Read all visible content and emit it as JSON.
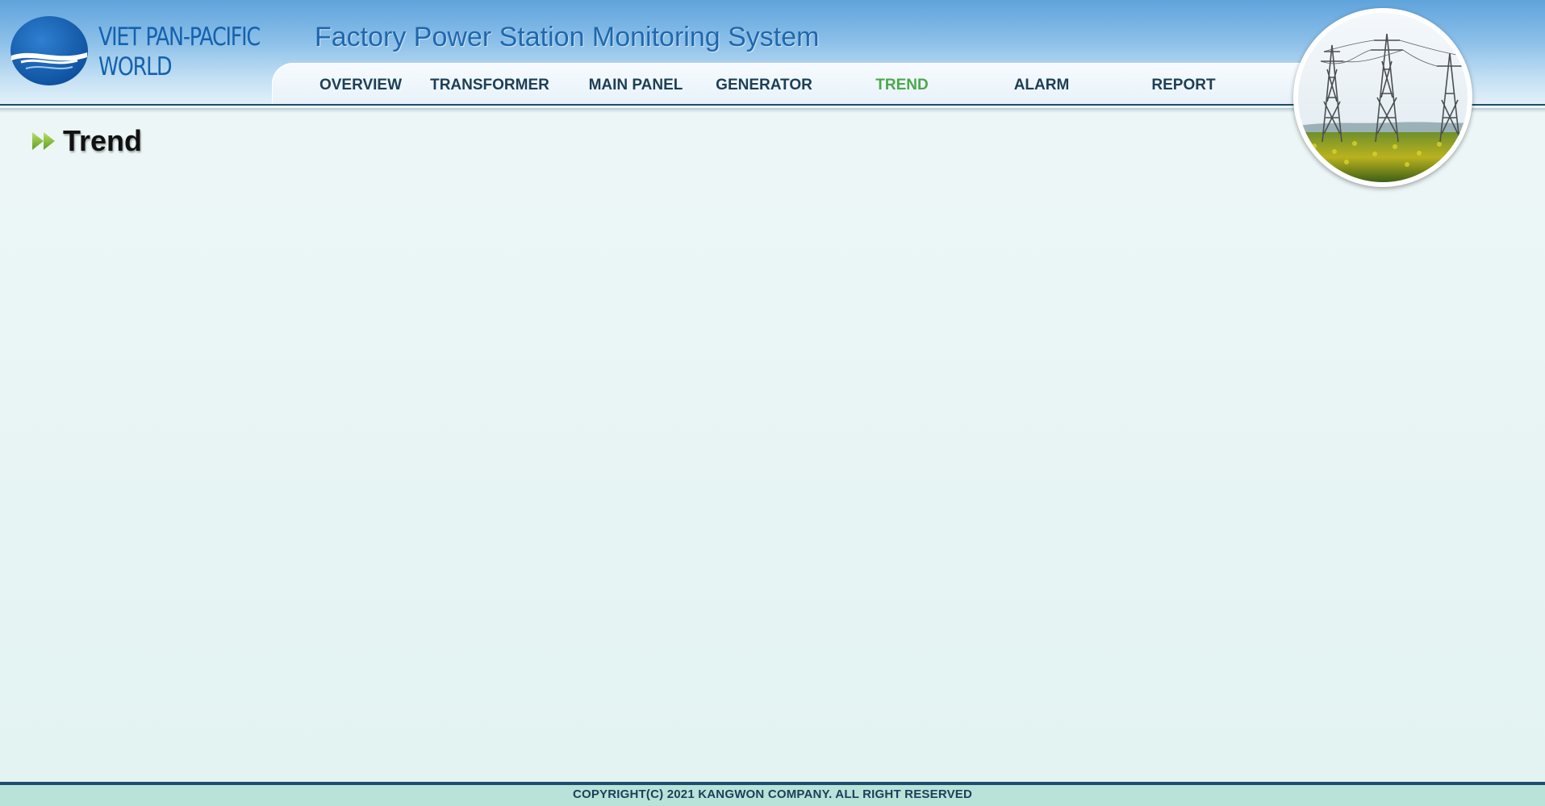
{
  "brand": {
    "logo_line1": "VIET PAN-PACIFIC",
    "logo_line2": "WORLD"
  },
  "app_title": "Factory Power Station Monitoring System",
  "nav": {
    "items": [
      {
        "label": "OVERVIEW",
        "active": false
      },
      {
        "label": "TRANSFORMER",
        "active": false
      },
      {
        "label": "MAIN PANEL",
        "active": false
      },
      {
        "label": "GENERATOR",
        "active": false
      },
      {
        "label": "TREND",
        "active": true
      },
      {
        "label": "ALARM",
        "active": false
      },
      {
        "label": "REPORT",
        "active": false
      }
    ]
  },
  "page": {
    "title": "Trend"
  },
  "footer": {
    "copyright": "COPYRIGHT(C) 2021 KANGWON COMPANY. ALL RIGHT RESERVED"
  },
  "colors": {
    "nav_active": "#4aa84b",
    "nav_text": "#1c3f57",
    "brand_blue": "#1462ae",
    "rule": "#1f4e6c"
  }
}
